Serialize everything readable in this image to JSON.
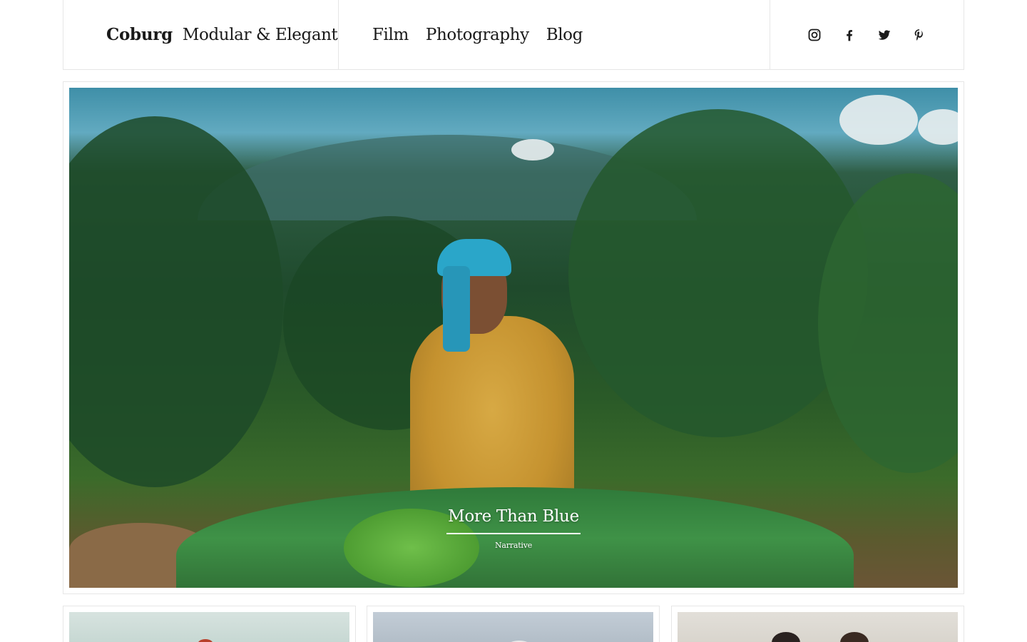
{
  "brand": {
    "name": "Coburg",
    "tagline": "Modular & Elegant"
  },
  "nav": {
    "items": [
      {
        "label": "Film"
      },
      {
        "label": "Photography"
      },
      {
        "label": "Blog"
      }
    ]
  },
  "social": {
    "icons": [
      "instagram-icon",
      "facebook-icon",
      "twitter-icon",
      "pinterest-icon"
    ]
  },
  "hero": {
    "title": "More Than Blue",
    "category": "Narrative"
  },
  "colors": {
    "text": "#1a1a1a",
    "border": "#e6e6e6",
    "caption": "#ffffff"
  }
}
